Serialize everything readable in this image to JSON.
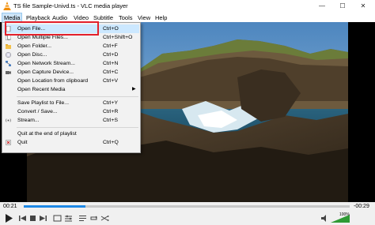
{
  "window": {
    "title": "TS file Sample-Univd.ts - VLC media player",
    "controls": {
      "minimize": "—",
      "maximize": "☐",
      "close": "✕"
    }
  },
  "menubar": [
    "Media",
    "Playback",
    "Audio",
    "Video",
    "Subtitle",
    "Tools",
    "View",
    "Help"
  ],
  "media_menu": {
    "items": [
      {
        "label": "Open File...",
        "shortcut": "Ctrl+O",
        "icon": "file-icon"
      },
      {
        "label": "Open Multiple Files...",
        "shortcut": "Ctrl+Shift+O",
        "icon": "multiple-files-icon"
      },
      {
        "label": "Open Folder...",
        "shortcut": "Ctrl+F",
        "icon": "folder-icon"
      },
      {
        "label": "Open Disc...",
        "shortcut": "Ctrl+D",
        "icon": "disc-icon"
      },
      {
        "label": "Open Network Stream...",
        "shortcut": "Ctrl+N",
        "icon": "network-icon"
      },
      {
        "label": "Open Capture Device...",
        "shortcut": "Ctrl+C",
        "icon": "capture-device-icon"
      },
      {
        "label": "Open Location from clipboard",
        "shortcut": "Ctrl+V",
        "icon": ""
      },
      {
        "label": "Open Recent Media",
        "shortcut": "",
        "icon": ""
      },
      {
        "label": "Save Playlist to File...",
        "shortcut": "Ctrl+Y",
        "icon": ""
      },
      {
        "label": "Convert / Save...",
        "shortcut": "Ctrl+R",
        "icon": ""
      },
      {
        "label": "Stream...",
        "shortcut": "Ctrl+S",
        "icon": "stream-icon"
      },
      {
        "label": "Quit at the end of playlist",
        "shortcut": "",
        "icon": ""
      },
      {
        "label": "Quit",
        "shortcut": "Ctrl+Q",
        "icon": "quit-icon"
      }
    ],
    "submenu_arrow": "▶"
  },
  "player": {
    "elapsed": "00:21",
    "remaining": "-00:29",
    "progress_fraction": 0.19,
    "volume": "100%",
    "accent_color": "#1e88e5",
    "highlight_color": "#e3202b"
  }
}
